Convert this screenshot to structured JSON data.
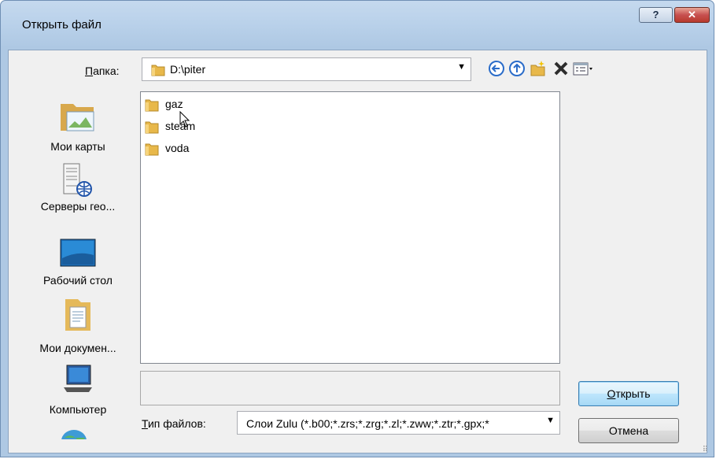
{
  "window": {
    "title": "Открыть файл",
    "help_glyph": "?",
    "close_glyph": "✕"
  },
  "toolbar": {
    "lookin_label": "Папка:",
    "lookin_value": "D:\\piter",
    "icons": [
      "back-icon",
      "up-icon",
      "new-folder-icon",
      "delete-icon",
      "view-menu-icon"
    ]
  },
  "places": [
    {
      "label": "Мои карты",
      "icon": "my-maps-icon"
    },
    {
      "label": "Серверы гео...",
      "icon": "geo-servers-icon"
    },
    {
      "label": "Рабочий стол",
      "icon": "desktop-icon"
    },
    {
      "label": "Мои докумен...",
      "icon": "my-documents-icon"
    },
    {
      "label": "Компьютер",
      "icon": "computer-icon"
    }
  ],
  "files": [
    {
      "name": "gaz",
      "type": "folder"
    },
    {
      "name": "steam",
      "type": "folder"
    },
    {
      "name": "voda",
      "type": "folder"
    }
  ],
  "filetype": {
    "label": "Тип файлов:",
    "value": "Слои Zulu (*.b00;*.zrs;*.zrg;*.zl;*.zww;*.ztr;*.gpx;*"
  },
  "buttons": {
    "open": "Открыть",
    "cancel": "Отмена"
  },
  "colors": {
    "titlebar": "#b9d1ea",
    "close_button": "#c75050",
    "default_button_border": "#3c7fb1",
    "folder": "#e8b84a"
  }
}
